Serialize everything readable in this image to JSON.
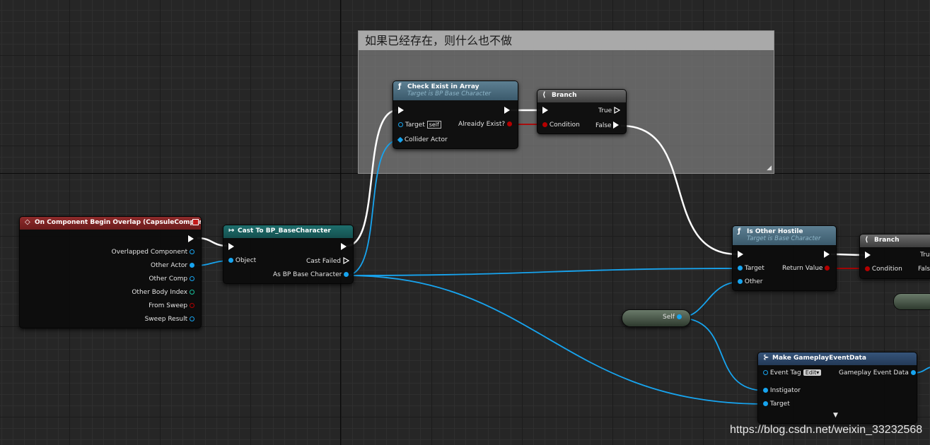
{
  "comment": {
    "title": "如果已经存在，则什么也不做"
  },
  "nodes": {
    "check_exist": {
      "title": "Check Exist in Array",
      "subtitle": "Target is BP Base Character",
      "icon": "function-icon",
      "pins": {
        "target": "Target",
        "target_default": "self",
        "collider_actor": "Collider Actor",
        "already_exist": "Alreaidy Exist?"
      }
    },
    "branch1": {
      "title": "Branch",
      "pins": {
        "true": "True",
        "false": "False",
        "condition": "Condition"
      }
    },
    "on_overlap": {
      "title": "On Component Begin Overlap (CapsuleComponent)",
      "pins": [
        "Overlapped Component",
        "Other Actor",
        "Other Comp",
        "Other Body Index",
        "From Sweep",
        "Sweep Result"
      ]
    },
    "cast": {
      "title": "Cast To BP_BaseCharacter",
      "pins": {
        "object": "Object",
        "cast_failed": "Cast Failed",
        "as_bp": "As BP Base Character"
      }
    },
    "is_hostile": {
      "title": "Is Other Hostile",
      "subtitle": "Target is Base Character",
      "pins": {
        "target": "Target",
        "other": "Other",
        "return_value": "Return Value"
      }
    },
    "branch2": {
      "title": "Branch",
      "pins": {
        "true": "Tru",
        "false": "Fals",
        "condition": "Condition"
      }
    },
    "self_node": {
      "label": "Self"
    },
    "make_event": {
      "title": "Make GameplayEventData",
      "pins": {
        "event_tag": "Event Tag",
        "edit": "Edit",
        "gameplay_event_data": "Gameplay Event Data",
        "instigator": "Instigator",
        "target": "Target"
      },
      "expand_icon": "▼"
    }
  },
  "watermark": "https://blog.csdn.net/weixin_33232568",
  "colors": {
    "object_pin": "#17a4ef",
    "bool_pin": "#b50000",
    "int_pin": "#16c29c",
    "exec_wire": "#ffffff"
  }
}
